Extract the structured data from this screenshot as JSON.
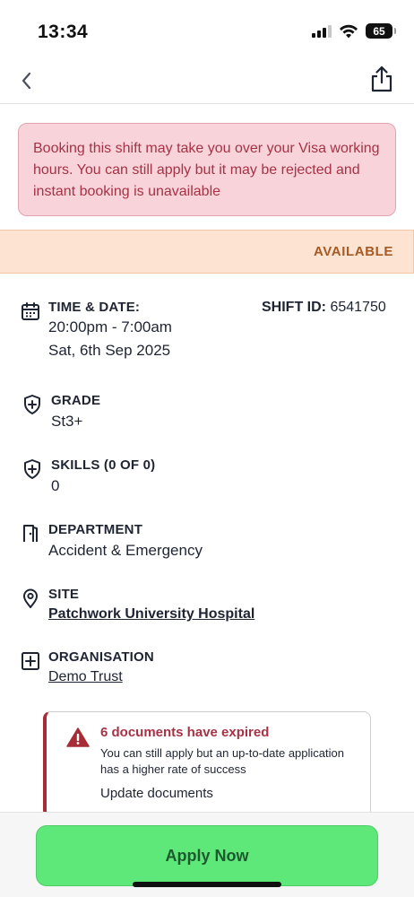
{
  "status_bar": {
    "time": "13:34",
    "battery": "65"
  },
  "nav": {
    "back_icon": "chevron-left-icon",
    "share_icon": "share-icon"
  },
  "visa_alert": {
    "text": "Booking this shift may take you over your Visa working hours. You can still apply but it may be rejected and instant booking is unavailable"
  },
  "status_banner": {
    "label": "AVAILABLE"
  },
  "shift": {
    "id_label": "SHIFT ID:",
    "id_value": "6541750"
  },
  "details": {
    "time_date": {
      "label": "TIME & DATE:",
      "time": "20:00pm - 7:00am",
      "date": "Sat, 6th Sep 2025",
      "icon": "calendar-icon"
    },
    "grade": {
      "label": "GRADE",
      "value": "St3+",
      "icon": "shield-plus-icon"
    },
    "skills": {
      "label": "SKILLS (0 OF 0)",
      "value": "0",
      "icon": "shield-plus-icon"
    },
    "department": {
      "label": "DEPARTMENT",
      "value": "Accident & Emergency",
      "icon": "door-icon"
    },
    "site": {
      "label": "SITE",
      "value": "Patchwork University Hospital",
      "icon": "location-pin-icon"
    },
    "organisation": {
      "label": "ORGANISATION",
      "value": "Demo Trust",
      "icon": "plus-square-icon"
    }
  },
  "doc_alert": {
    "title": "6 documents have expired",
    "text": "You can still apply but an up-to-date application has a higher rate of success",
    "action": "Update documents",
    "icon": "warning-icon"
  },
  "apply": {
    "label": "Apply Now"
  },
  "colors": {
    "alert_bg": "#f8d4da",
    "alert_text": "#a63246",
    "available_bg": "#fce3d2",
    "available_text": "#a65a24",
    "apply_bg": "#5fe87a",
    "apply_text": "#1c5a2e"
  }
}
